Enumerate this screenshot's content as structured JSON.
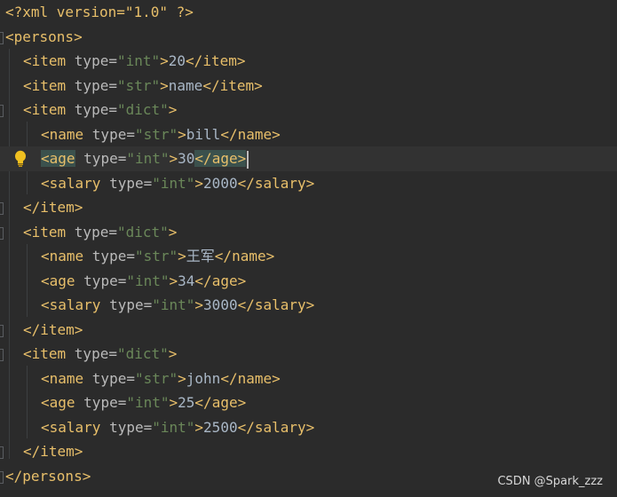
{
  "editor": {
    "lines": {
      "l0": {
        "text": "<?xml version=\"1.0\" ?>"
      },
      "l1": {
        "open": "<persons>"
      },
      "l2": {
        "open": "<item ",
        "attr": "type",
        "eq": "=",
        "val": "\"int\"",
        "gt": ">",
        "content": "20",
        "close": "</item>"
      },
      "l3": {
        "open": "<item ",
        "attr": "type",
        "eq": "=",
        "val": "\"str\"",
        "gt": ">",
        "content": "name",
        "close": "</item>"
      },
      "l4": {
        "open": "<item ",
        "attr": "type",
        "eq": "=",
        "val": "\"dict\"",
        "gt": ">"
      },
      "l5": {
        "open": "<name ",
        "attr": "type",
        "eq": "=",
        "val": "\"str\"",
        "gt": ">",
        "content": "bill",
        "close": "</name>"
      },
      "l6": {
        "open": "<age",
        "space": " ",
        "attr": "type",
        "eq": "=",
        "val": "\"int\"",
        "gt": ">",
        "content": "30",
        "close": "</age>"
      },
      "l7": {
        "open": "<salary ",
        "attr": "type",
        "eq": "=",
        "val": "\"int\"",
        "gt": ">",
        "content": "2000",
        "close": "</salary>"
      },
      "l8": {
        "close": "</item>"
      },
      "l9": {
        "open": "<item ",
        "attr": "type",
        "eq": "=",
        "val": "\"dict\"",
        "gt": ">"
      },
      "l10": {
        "open": "<name ",
        "attr": "type",
        "eq": "=",
        "val": "\"str\"",
        "gt": ">",
        "content": "王军",
        "close": "</name>"
      },
      "l11": {
        "open": "<age ",
        "attr": "type",
        "eq": "=",
        "val": "\"int\"",
        "gt": ">",
        "content": "34",
        "close": "</age>"
      },
      "l12": {
        "open": "<salary ",
        "attr": "type",
        "eq": "=",
        "val": "\"int\"",
        "gt": ">",
        "content": "3000",
        "close": "</salary>"
      },
      "l13": {
        "close": "</item>"
      },
      "l14": {
        "open": "<item ",
        "attr": "type",
        "eq": "=",
        "val": "\"dict\"",
        "gt": ">"
      },
      "l15": {
        "open": "<name ",
        "attr": "type",
        "eq": "=",
        "val": "\"str\"",
        "gt": ">",
        "content": "john",
        "close": "</name>"
      },
      "l16": {
        "open": "<age ",
        "attr": "type",
        "eq": "=",
        "val": "\"int\"",
        "gt": ">",
        "content": "25",
        "close": "</age>"
      },
      "l17": {
        "open": "<salary ",
        "attr": "type",
        "eq": "=",
        "val": "\"int\"",
        "gt": ">",
        "content": "2500",
        "close": "</salary>"
      },
      "l18": {
        "close": "</item>"
      },
      "l19": {
        "close": "</persons>"
      }
    },
    "gutter_icons": [
      "lightbulb-icon",
      "fold-marker-icon"
    ],
    "colors": {
      "background": "#2b2b2b",
      "current_line": "#323232",
      "tag": "#e8bf6a",
      "attribute": "#bababa",
      "attribute_value": "#6a8759",
      "text": "#a9b7c6",
      "tag_match_highlight": "#3b514d",
      "lightbulb": "#f0c020"
    }
  },
  "watermark": {
    "text": "CSDN @Spark_zzz"
  }
}
